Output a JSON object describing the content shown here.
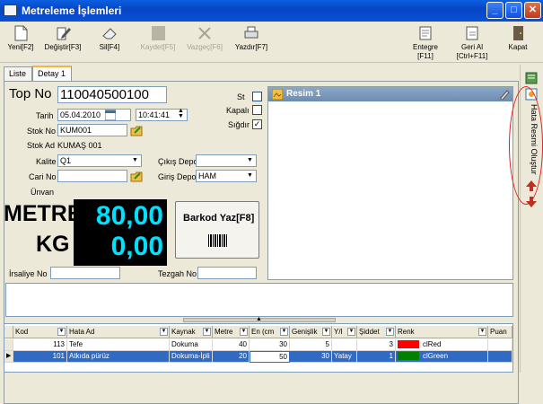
{
  "window": {
    "title": "Metreleme İşlemleri"
  },
  "toolbar": {
    "yeni": "Yeni[F2]",
    "degistir": "Değiştir[F3]",
    "sil": "Sil[F4]",
    "kaydet": "Kaydet[F5]",
    "vazgec": "Vazgeç[F6]",
    "yazdir": "Yazdır[F7]",
    "entegre1": "Entegre",
    "entegre2": "[F11]",
    "gerial1": "Geri Al",
    "gerial2": "[Ctrl+F11]",
    "kapat": "Kapat"
  },
  "tabs": {
    "liste": "Liste",
    "detay": "Detay 1"
  },
  "form": {
    "top_no_label": "Top No",
    "top_no": "110040500100",
    "tarih_label": "Tarih",
    "tarih": "05.04.2010",
    "saat": "10:41:41",
    "stok_no_label": "Stok No",
    "stok_no": "KUM001",
    "stok_ad_label": "Stok Ad",
    "stok_ad": "KUMAŞ 001",
    "kalite_label": "Kalite",
    "kalite": "Q1",
    "cari_no_label": "Cari No",
    "cari_no": "",
    "unvan_label": "Ünvan",
    "cikis_depo_label": "Çıkış Depo",
    "cikis_depo": "",
    "giris_depo_label": "Giriş Depo",
    "giris_depo": "HAM",
    "st_label": "St",
    "kapali_label": "Kapalı",
    "sigdir_label": "Sığdır",
    "st_checked": false,
    "kapali_checked": false,
    "sigdir_checked": true,
    "irsaliye_label": "İrsaliye No",
    "irsaliye_no": "",
    "tezgah_label": "Tezgah No",
    "tezgah_no": ""
  },
  "measure": {
    "metre_label": "METRE",
    "kg_label": "KG",
    "metre": "80,00",
    "kg": "0,00",
    "barkod_button": "Barkod Yaz[F8]"
  },
  "resim": {
    "title": "Resim 1"
  },
  "sidebar": {
    "hata_resmi": "Hata Resmi Oluştur"
  },
  "grid": {
    "columns": [
      "Kod",
      "Hata Ad",
      "Kaynak",
      "Metre",
      "En (cm",
      "Genişlik",
      "Y/I",
      "Şiddet",
      "Renk",
      "Puan"
    ],
    "rows": [
      {
        "kod": "113",
        "hata": "Tefe",
        "kaynak": "Dokuma",
        "metre": "40",
        "en": "30",
        "genislik": "5",
        "yi": "",
        "siddet": "3",
        "renk_color": "#ff0000",
        "renk": "clRed",
        "puan": ""
      },
      {
        "kod": "101",
        "hata": "Atkıda pürüz",
        "kaynak": "Dokuma-İpli",
        "metre": "20",
        "en": "50",
        "genislik": "30",
        "yi": "Yatay",
        "siddet": "1",
        "renk_color": "#008000",
        "renk": "clGreen",
        "puan": ""
      }
    ]
  },
  "colors": {
    "title_bar": "#0a4fd6",
    "display_bg": "#000000",
    "display_text": "#00e0ff",
    "selected_row": "#316ac5",
    "annotation": "#e02020"
  }
}
